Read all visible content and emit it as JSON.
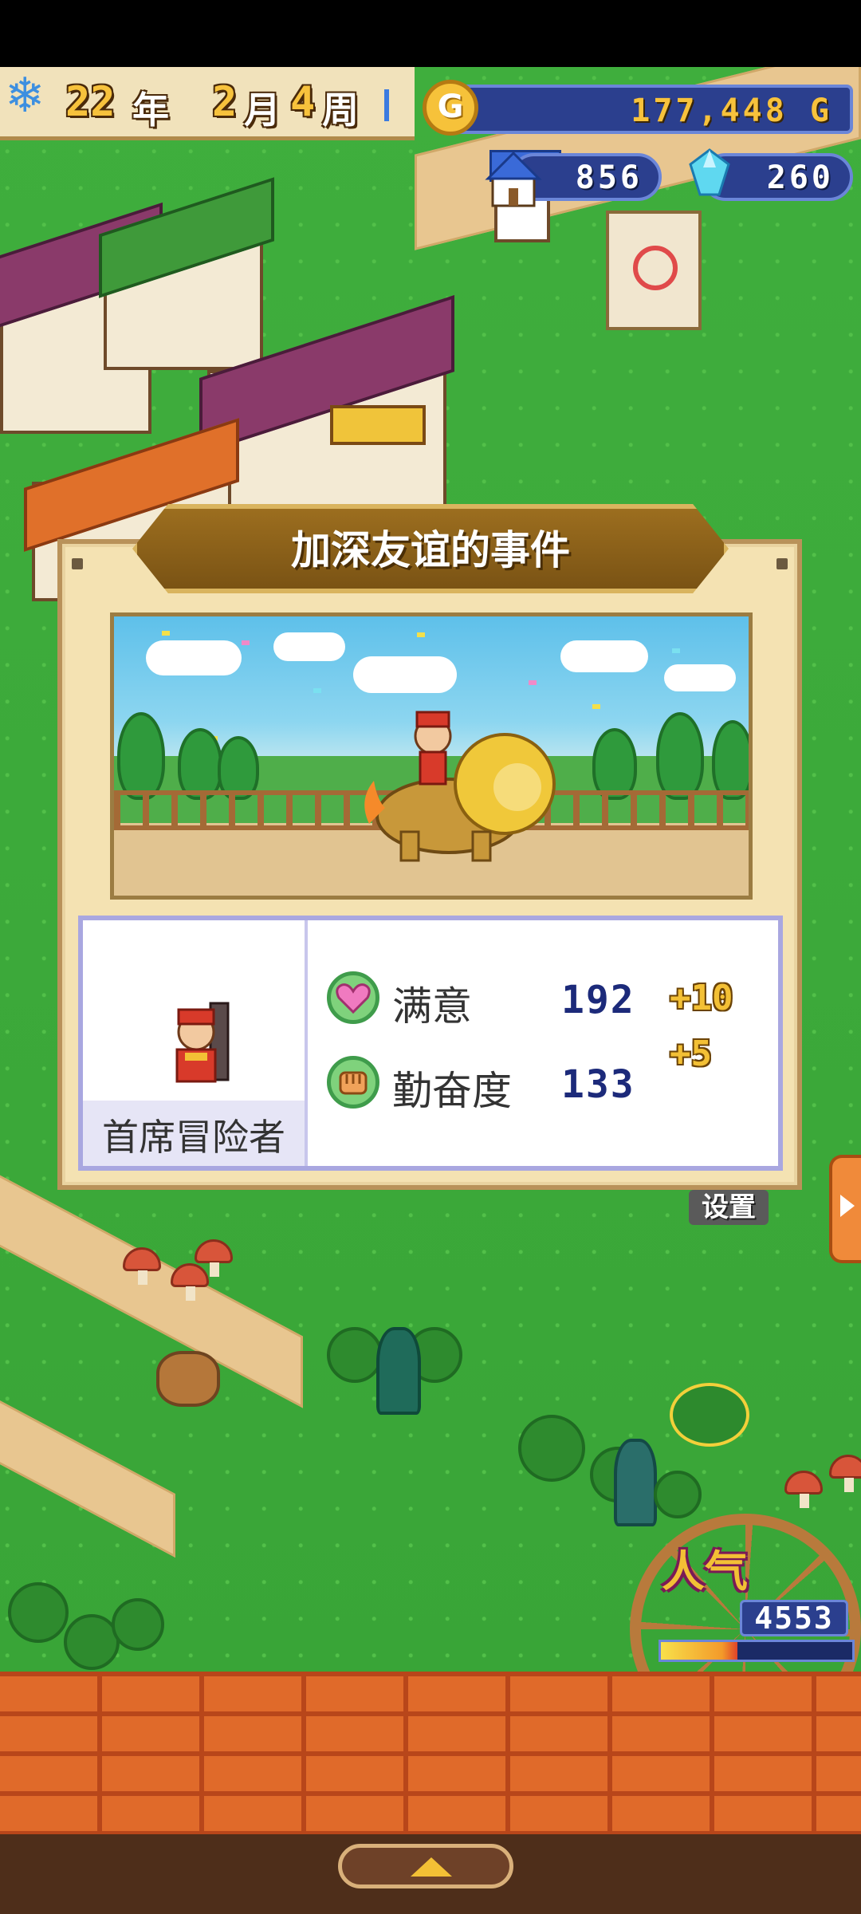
{
  "hud": {
    "year_num": "22",
    "year_unit": "年",
    "month_num": "2",
    "month_unit": "月",
    "week_num": "4",
    "week_unit": "周",
    "gold_symbol": "G",
    "gold_value": "177,448 G",
    "houses_value": "856",
    "gems_value": "260",
    "season_icon": "snowflake-icon"
  },
  "dialog": {
    "title": "加深友谊的事件",
    "character_title": "首席冒险者",
    "stats": [
      {
        "icon": "heart-icon",
        "label": "满意",
        "value": "192",
        "change": "+10"
      },
      {
        "icon": "fist-icon",
        "label": "勤奋度",
        "value": "133",
        "change": "+5"
      }
    ]
  },
  "settings_label": "设置",
  "popularity": {
    "label": "人气",
    "value": "4553",
    "bar_fraction": 0.4
  },
  "colors": {
    "hud_blue": "#2b3f8e",
    "gold_text": "#f7c23c",
    "grass": "#3fae3d",
    "brick": "#e06a2a"
  }
}
